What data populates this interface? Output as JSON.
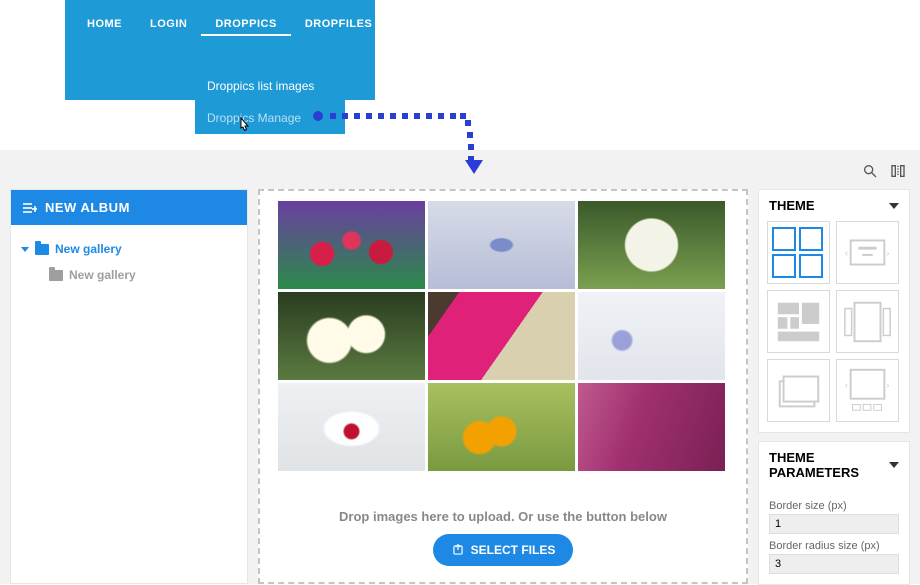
{
  "nav": {
    "items": [
      "HOME",
      "LOGIN",
      "DROPPICS",
      "DROPFILES"
    ],
    "active_index": 2,
    "submenu": [
      "Droppics list images",
      "Droppics Manage"
    ]
  },
  "sidebar": {
    "new_album": "NEW ALBUM",
    "tree": {
      "root": "New gallery",
      "child": "New gallery"
    }
  },
  "main": {
    "drop_text": "Drop images here to upload. Or use the button below",
    "select_button": "SELECT FILES"
  },
  "theme_panel": {
    "title": "THEME"
  },
  "params_panel": {
    "title": "THEME PARAMETERS",
    "border_size_label": "Border size (px)",
    "border_size_value": "1",
    "border_radius_label": "Border radius size (px)",
    "border_radius_value": "3"
  }
}
